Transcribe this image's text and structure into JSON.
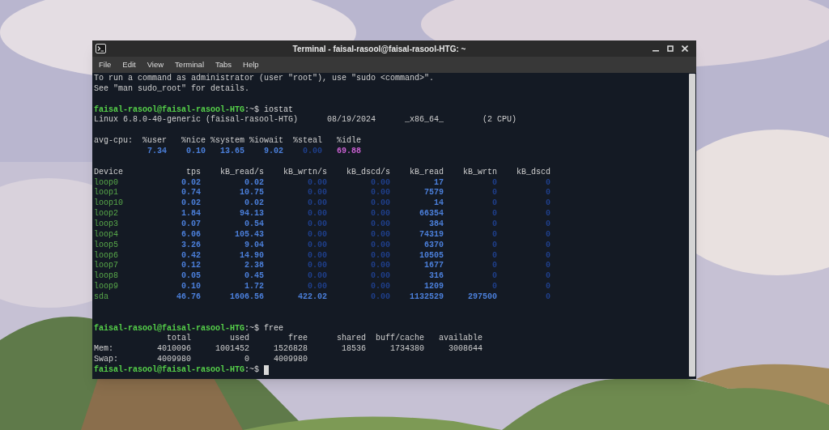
{
  "window": {
    "title": "Terminal - faisal-rasool@faisal-rasool-HTG: ~"
  },
  "menu": [
    "File",
    "Edit",
    "View",
    "Terminal",
    "Tabs",
    "Help"
  ],
  "terminal": {
    "lines": [
      {
        "kind": "text",
        "text": "To run a command as administrator (user \"root\"), use \"sudo <command>\"."
      },
      {
        "kind": "text",
        "text": "See \"man sudo_root\" for details."
      },
      {
        "kind": "blank"
      },
      {
        "kind": "prompt",
        "user": "faisal-rasool@faisal-rasool-HTG",
        "path": ":~$",
        "command": "iostat",
        "cursor": false
      },
      {
        "kind": "sysinfo",
        "fields": [
          "Linux 6.8.0-40-generic (faisal-rasool-HTG)",
          "08/19/2024",
          "_x86_64_",
          "(2 CPU)"
        ]
      },
      {
        "kind": "blank"
      },
      {
        "kind": "cpu",
        "label": "avg-cpu:",
        "stats": [
          {
            "name": "%user",
            "value": "7.34",
            "dim": false,
            "highlight": false
          },
          {
            "name": "%nice",
            "value": "0.10",
            "dim": false,
            "highlight": false
          },
          {
            "name": "%system",
            "value": "13.65",
            "dim": false,
            "highlight": false
          },
          {
            "name": "%iowait",
            "value": "9.02",
            "dim": false,
            "highlight": false
          },
          {
            "name": "%steal",
            "value": "0.00",
            "dim": true,
            "highlight": false
          },
          {
            "name": "%idle",
            "value": "69.88",
            "dim": false,
            "highlight": true
          }
        ]
      },
      {
        "kind": "blank"
      },
      {
        "kind": "devices",
        "columns": [
          "Device",
          "tps",
          "kB_read/s",
          "kB_wrtn/s",
          "kB_dscd/s",
          "kB_read",
          "kB_wrtn",
          "kB_dscd"
        ],
        "rows": [
          {
            "device": "loop0",
            "values": [
              {
                "text": "0.02",
                "dim": false
              },
              {
                "text": "0.02",
                "dim": false
              },
              {
                "text": "0.00",
                "dim": true
              },
              {
                "text": "0.00",
                "dim": true
              },
              {
                "text": "17",
                "dim": false
              },
              {
                "text": "0",
                "dim": true
              },
              {
                "text": "0",
                "dim": true
              }
            ]
          },
          {
            "device": "loop1",
            "values": [
              {
                "text": "0.74",
                "dim": false
              },
              {
                "text": "10.75",
                "dim": false
              },
              {
                "text": "0.00",
                "dim": true
              },
              {
                "text": "0.00",
                "dim": true
              },
              {
                "text": "7579",
                "dim": false
              },
              {
                "text": "0",
                "dim": true
              },
              {
                "text": "0",
                "dim": true
              }
            ]
          },
          {
            "device": "loop10",
            "values": [
              {
                "text": "0.02",
                "dim": false
              },
              {
                "text": "0.02",
                "dim": false
              },
              {
                "text": "0.00",
                "dim": true
              },
              {
                "text": "0.00",
                "dim": true
              },
              {
                "text": "14",
                "dim": false
              },
              {
                "text": "0",
                "dim": true
              },
              {
                "text": "0",
                "dim": true
              }
            ]
          },
          {
            "device": "loop2",
            "values": [
              {
                "text": "1.84",
                "dim": false
              },
              {
                "text": "94.13",
                "dim": false
              },
              {
                "text": "0.00",
                "dim": true
              },
              {
                "text": "0.00",
                "dim": true
              },
              {
                "text": "66354",
                "dim": false
              },
              {
                "text": "0",
                "dim": true
              },
              {
                "text": "0",
                "dim": true
              }
            ]
          },
          {
            "device": "loop3",
            "values": [
              {
                "text": "0.07",
                "dim": false
              },
              {
                "text": "0.54",
                "dim": false
              },
              {
                "text": "0.00",
                "dim": true
              },
              {
                "text": "0.00",
                "dim": true
              },
              {
                "text": "384",
                "dim": false
              },
              {
                "text": "0",
                "dim": true
              },
              {
                "text": "0",
                "dim": true
              }
            ]
          },
          {
            "device": "loop4",
            "values": [
              {
                "text": "6.06",
                "dim": false
              },
              {
                "text": "105.43",
                "dim": false
              },
              {
                "text": "0.00",
                "dim": true
              },
              {
                "text": "0.00",
                "dim": true
              },
              {
                "text": "74319",
                "dim": false
              },
              {
                "text": "0",
                "dim": true
              },
              {
                "text": "0",
                "dim": true
              }
            ]
          },
          {
            "device": "loop5",
            "values": [
              {
                "text": "3.26",
                "dim": false
              },
              {
                "text": "9.04",
                "dim": false
              },
              {
                "text": "0.00",
                "dim": true
              },
              {
                "text": "0.00",
                "dim": true
              },
              {
                "text": "6370",
                "dim": false
              },
              {
                "text": "0",
                "dim": true
              },
              {
                "text": "0",
                "dim": true
              }
            ]
          },
          {
            "device": "loop6",
            "values": [
              {
                "text": "0.42",
                "dim": false
              },
              {
                "text": "14.90",
                "dim": false
              },
              {
                "text": "0.00",
                "dim": true
              },
              {
                "text": "0.00",
                "dim": true
              },
              {
                "text": "10505",
                "dim": false
              },
              {
                "text": "0",
                "dim": true
              },
              {
                "text": "0",
                "dim": true
              }
            ]
          },
          {
            "device": "loop7",
            "values": [
              {
                "text": "0.12",
                "dim": false
              },
              {
                "text": "2.38",
                "dim": false
              },
              {
                "text": "0.00",
                "dim": true
              },
              {
                "text": "0.00",
                "dim": true
              },
              {
                "text": "1677",
                "dim": false
              },
              {
                "text": "0",
                "dim": true
              },
              {
                "text": "0",
                "dim": true
              }
            ]
          },
          {
            "device": "loop8",
            "values": [
              {
                "text": "0.05",
                "dim": false
              },
              {
                "text": "0.45",
                "dim": false
              },
              {
                "text": "0.00",
                "dim": true
              },
              {
                "text": "0.00",
                "dim": true
              },
              {
                "text": "316",
                "dim": false
              },
              {
                "text": "0",
                "dim": true
              },
              {
                "text": "0",
                "dim": true
              }
            ]
          },
          {
            "device": "loop9",
            "values": [
              {
                "text": "0.10",
                "dim": false
              },
              {
                "text": "1.72",
                "dim": false
              },
              {
                "text": "0.00",
                "dim": true
              },
              {
                "text": "0.00",
                "dim": true
              },
              {
                "text": "1209",
                "dim": false
              },
              {
                "text": "0",
                "dim": true
              },
              {
                "text": "0",
                "dim": true
              }
            ]
          },
          {
            "device": "sda",
            "values": [
              {
                "text": "46.76",
                "dim": false
              },
              {
                "text": "1606.56",
                "dim": false
              },
              {
                "text": "422.02",
                "dim": false
              },
              {
                "text": "0.00",
                "dim": true
              },
              {
                "text": "1132529",
                "dim": false
              },
              {
                "text": "297500",
                "dim": false
              },
              {
                "text": "0",
                "dim": true
              }
            ]
          }
        ]
      },
      {
        "kind": "blank"
      },
      {
        "kind": "blank"
      },
      {
        "kind": "prompt",
        "user": "faisal-rasool@faisal-rasool-HTG",
        "path": ":~$",
        "command": "free",
        "cursor": false
      },
      {
        "kind": "memory",
        "columns": [
          "total",
          "used",
          "free",
          "shared",
          "buff/cache",
          "available"
        ],
        "rows": [
          {
            "label": "Mem:",
            "values": [
              "4010096",
              "1001452",
              "1526828",
              "18536",
              "1734380",
              "3008644"
            ]
          },
          {
            "label": "Swap:",
            "values": [
              "4009980",
              "0",
              "4009980"
            ]
          }
        ]
      },
      {
        "kind": "prompt",
        "user": "faisal-rasool@faisal-rasool-HTG",
        "path": ":~$",
        "cursor": true
      }
    ]
  }
}
